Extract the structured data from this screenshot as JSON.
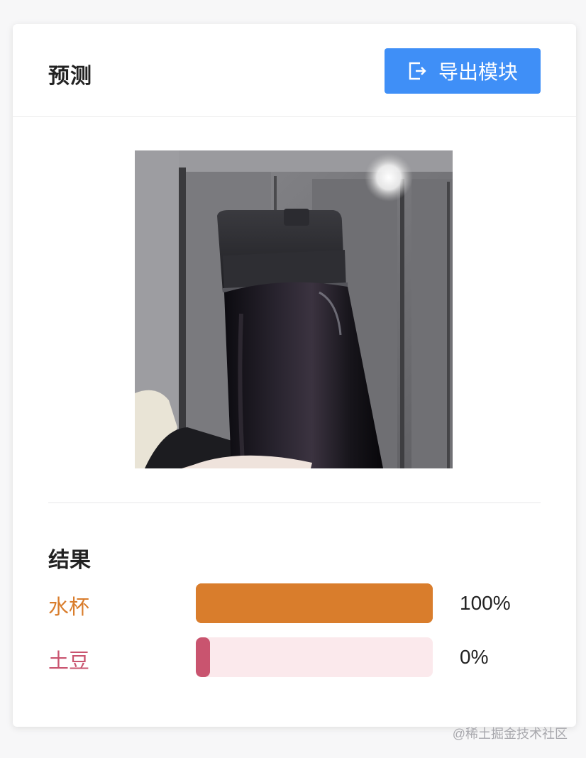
{
  "header": {
    "title": "预测",
    "export_button_label": "导出模块",
    "export_icon": "export-icon"
  },
  "preview": {
    "image_subject": "black-tumbler-photo"
  },
  "results": {
    "title": "结果",
    "items": [
      {
        "label": "水杯",
        "percent_text": "100%",
        "fraction": 1.0,
        "color": "#d97d2c",
        "track_color": "#d97d2c"
      },
      {
        "label": "土豆",
        "percent_text": "0%",
        "fraction": 0.0,
        "color": "#c9546f",
        "track_color": "#fbe9ec"
      }
    ]
  },
  "watermark": "@稀土掘金技术社区",
  "colors": {
    "accent": "#3f8ff7"
  }
}
